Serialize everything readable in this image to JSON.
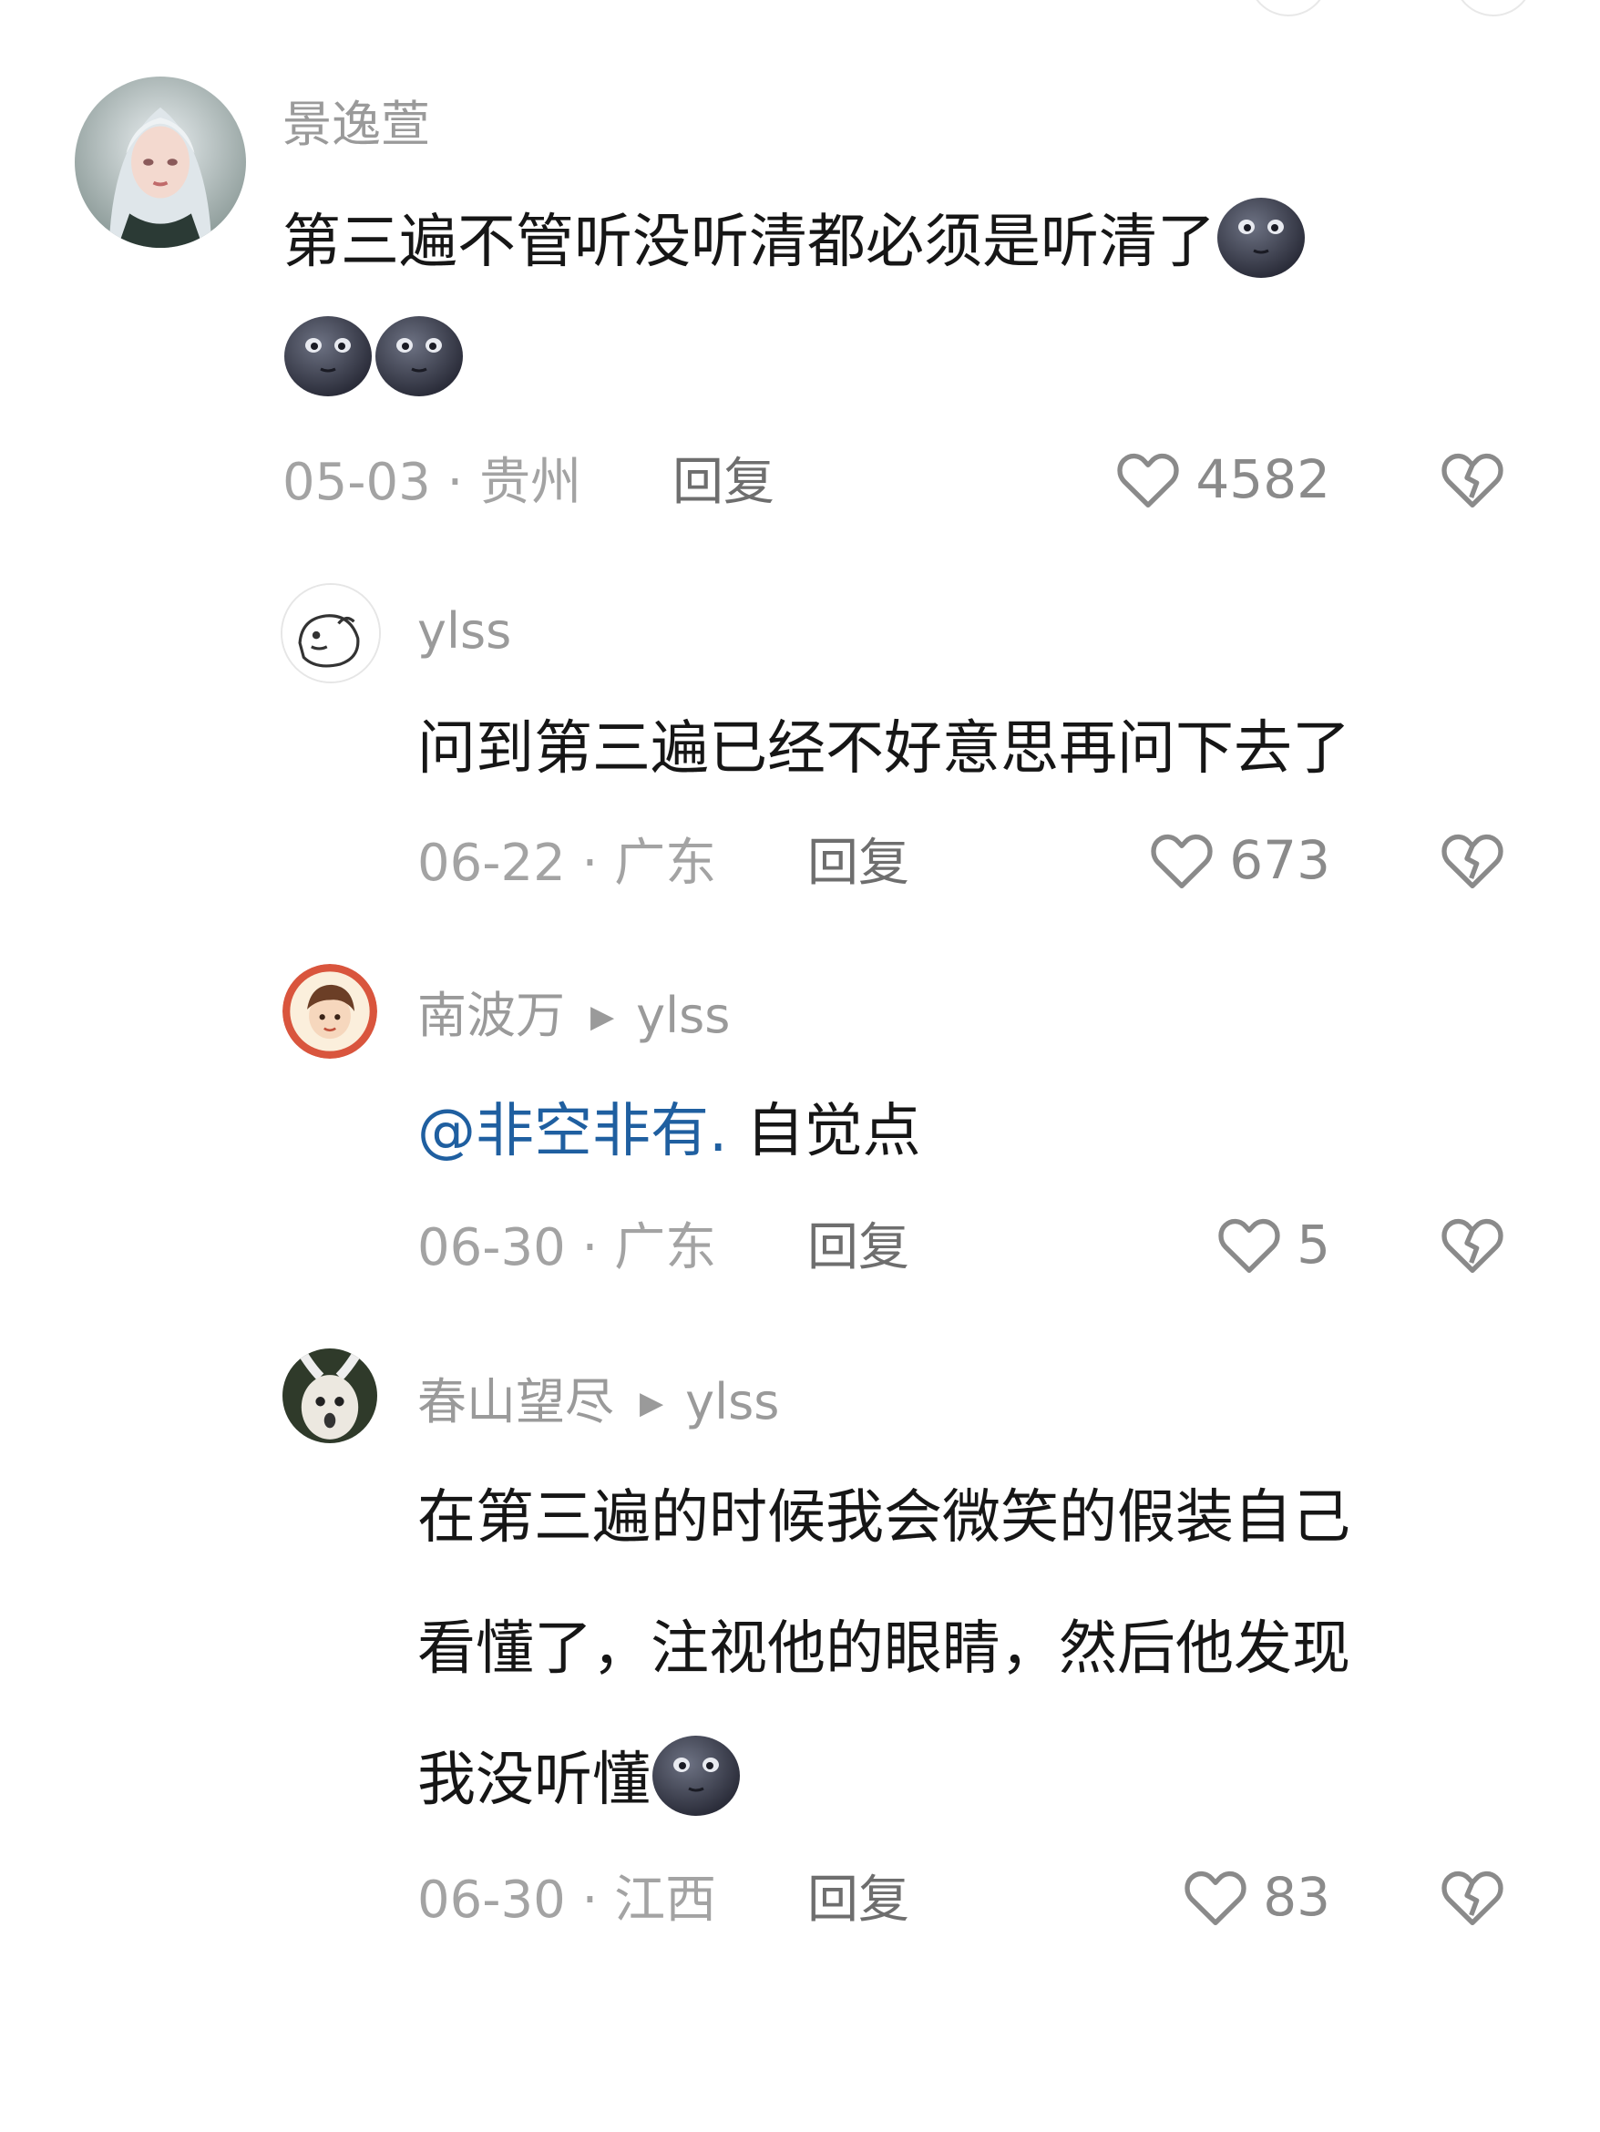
{
  "comments": [
    {
      "user": "景逸萱",
      "text_line1": "第三遍不管听没听清都必须是听清了",
      "emoji_name": "moon-face-emoji",
      "date": "05-03",
      "location": "贵州",
      "reply_label": "回复",
      "likes": "4582"
    },
    {
      "user": "ylss",
      "text": "问到第三遍已经不好意思再问下去了",
      "date": "06-22",
      "location": "广东",
      "reply_label": "回复",
      "likes": "673"
    },
    {
      "user": "南波万",
      "reply_to": "ylss",
      "mention": "@非空非有.",
      "text": "自觉点",
      "date": "06-30",
      "location": "广东",
      "reply_label": "回复",
      "likes": "5"
    },
    {
      "user": "春山望尽",
      "reply_to": "ylss",
      "text_line1": "在第三遍的时候我会微笑的假装自己",
      "text_line2": "看懂了，注视他的眼睛，然后他发现",
      "text_line3": "我没听懂",
      "date": "06-30",
      "location": "江西",
      "reply_label": "回复",
      "likes": "83"
    }
  ],
  "meta_separator": " · ",
  "icons": {
    "like": "heart-outline-icon",
    "dislike": "broken-heart-icon",
    "reply_arrow": "triangle-right-icon"
  },
  "colors": {
    "mention": "#1f5fa0",
    "meta": "#a3a3a3",
    "text": "#161616"
  }
}
